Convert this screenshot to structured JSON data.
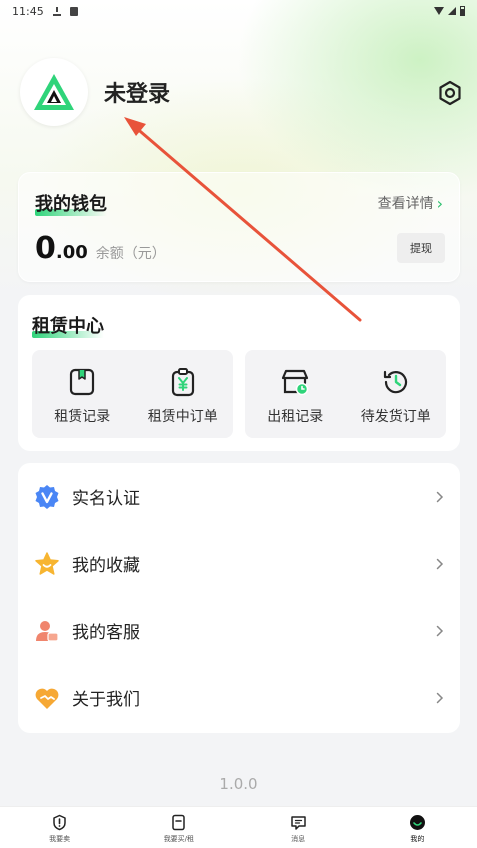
{
  "status_bar": {
    "time": "11:45"
  },
  "profile": {
    "name": "未登录",
    "avatar_icon": "app-logo-icon"
  },
  "wallet": {
    "title": "我的钱包",
    "detail_label": "查看详情",
    "balance_int": "0",
    "balance_dec": ".00",
    "balance_label": "余额（元）",
    "withdraw_label": "提现"
  },
  "rental_center": {
    "title": "租赁中心",
    "items": [
      {
        "label": "租赁记录",
        "icon": "bookmark-book-icon"
      },
      {
        "label": "租赁中订单",
        "icon": "clipboard-yen-icon"
      },
      {
        "label": "出租记录",
        "icon": "store-clock-icon"
      },
      {
        "label": "待发货订单",
        "icon": "history-clock-icon"
      }
    ]
  },
  "menu": [
    {
      "label": "实名认证",
      "icon": "verified-badge-icon"
    },
    {
      "label": "我的收藏",
      "icon": "star-icon"
    },
    {
      "label": "我的客服",
      "icon": "customer-service-icon"
    },
    {
      "label": "关于我们",
      "icon": "handshake-heart-icon"
    }
  ],
  "version": "1.0.0",
  "tabbar": [
    {
      "label": "我要卖",
      "icon": "sell-icon"
    },
    {
      "label": "我要买/租",
      "icon": "buy-icon"
    },
    {
      "label": "消息",
      "icon": "message-icon"
    },
    {
      "label": "我的",
      "icon": "profile-icon"
    }
  ],
  "colors": {
    "accent": "#2fd47a",
    "annotation_arrow": "#e8533a"
  }
}
